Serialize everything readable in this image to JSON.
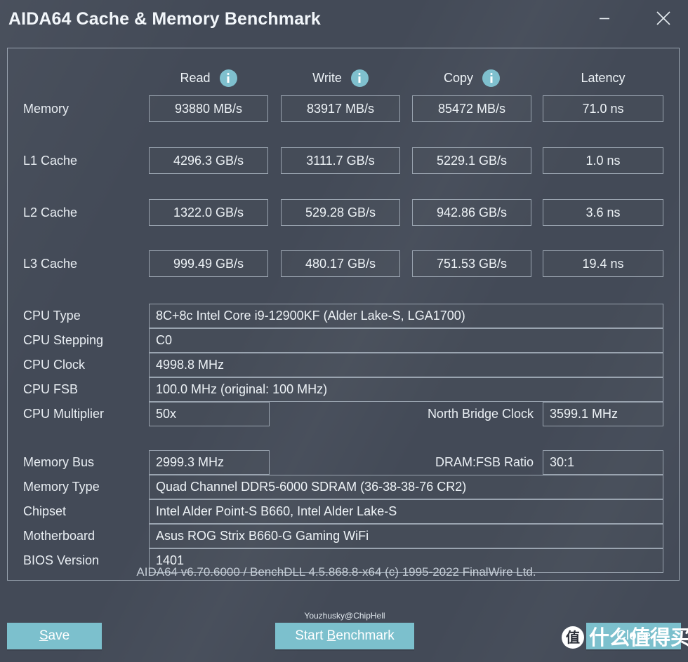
{
  "window": {
    "title": "AIDA64 Cache & Memory Benchmark",
    "minimize_icon": "minimize-icon",
    "close_icon": "close-icon"
  },
  "benchmark": {
    "columns": [
      {
        "label": "Read",
        "info_icon": "info-icon"
      },
      {
        "label": "Write",
        "info_icon": "info-icon"
      },
      {
        "label": "Copy",
        "info_icon": "info-icon"
      },
      {
        "label": "Latency",
        "info_icon": null
      }
    ],
    "rows": [
      {
        "label": "Memory",
        "read": "93880 MB/s",
        "write": "83917 MB/s",
        "copy": "85472 MB/s",
        "latency": "71.0 ns"
      },
      {
        "label": "L1 Cache",
        "read": "4296.3 GB/s",
        "write": "3111.7 GB/s",
        "copy": "5229.1 GB/s",
        "latency": "1.0 ns"
      },
      {
        "label": "L2 Cache",
        "read": "1322.0 GB/s",
        "write": "529.28 GB/s",
        "copy": "942.86 GB/s",
        "latency": "3.6 ns"
      },
      {
        "label": "L3 Cache",
        "read": "999.49 GB/s",
        "write": "480.17 GB/s",
        "copy": "751.53 GB/s",
        "latency": "19.4 ns"
      }
    ]
  },
  "cpu_info": {
    "type_label": "CPU Type",
    "type_value": "8C+8c Intel Core i9-12900KF  (Alder Lake-S, LGA1700)",
    "stepping_label": "CPU Stepping",
    "stepping_value": "C0",
    "clock_label": "CPU Clock",
    "clock_value": "4998.8 MHz",
    "fsb_label": "CPU FSB",
    "fsb_value": "100.0 MHz  (original: 100 MHz)",
    "multiplier_label": "CPU Multiplier",
    "multiplier_value": "50x",
    "north_bridge_label": "North Bridge Clock",
    "north_bridge_value": "3599.1 MHz"
  },
  "memory_info": {
    "bus_label": "Memory Bus",
    "bus_value": "2999.3 MHz",
    "dram_ratio_label": "DRAM:FSB Ratio",
    "dram_ratio_value": "30:1",
    "type_label": "Memory Type",
    "type_value": "Quad Channel DDR5-6000 SDRAM  (36-38-38-76 CR2)",
    "chipset_label": "Chipset",
    "chipset_value": "Intel Alder Point-S B660, Intel Alder Lake-S",
    "motherboard_label": "Motherboard",
    "motherboard_value": "Asus ROG Strix B660-G Gaming WiFi",
    "bios_label": "BIOS Version",
    "bios_value": "1401"
  },
  "footer": {
    "version_line": "AIDA64 v6.70.6000 / BenchDLL 4.5.868.8-x64  (c) 1995-2022 FinalWire Ltd.",
    "credit": "Youzhusky@ChipHell",
    "save_label": "Save",
    "save_accel": "S",
    "save_rest": "ave",
    "start_pre": "Start ",
    "start_accel": "B",
    "start_rest": "enchmark",
    "close_label": "Close"
  },
  "watermark": {
    "badge": "值",
    "text": "什么值得买"
  },
  "colors": {
    "window_bg": "#434a57",
    "accent": "#7cc0cd",
    "border": "#9aa4b0",
    "text": "#e9eef3",
    "muted_text": "#c6ced7"
  }
}
